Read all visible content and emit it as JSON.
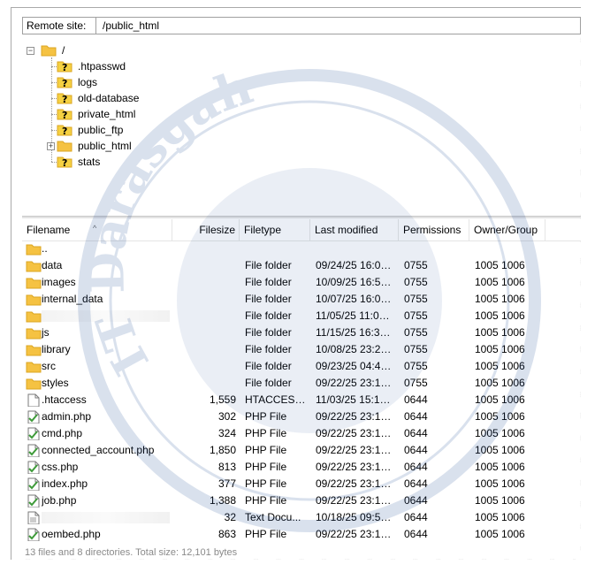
{
  "remote_site": {
    "label": "Remote site:",
    "path": "/public_html"
  },
  "tree": {
    "root": "/",
    "items": [
      {
        "label": ".htpasswd",
        "icon": "unknown-folder-icon"
      },
      {
        "label": "logs",
        "icon": "unknown-folder-icon"
      },
      {
        "label": "old-database",
        "icon": "unknown-folder-icon"
      },
      {
        "label": "private_html",
        "icon": "unknown-folder-icon"
      },
      {
        "label": "public_ftp",
        "icon": "unknown-folder-icon"
      },
      {
        "label": "public_html",
        "icon": "folder-icon",
        "expander": "+"
      },
      {
        "label": "stats",
        "icon": "unknown-folder-icon"
      }
    ]
  },
  "list": {
    "headers": {
      "filename": "Filename",
      "filesize": "Filesize",
      "filetype": "Filetype",
      "last_modified": "Last modified",
      "permissions": "Permissions",
      "owner_group": "Owner/Group"
    },
    "rows": [
      {
        "name": "..",
        "size": "",
        "type": "",
        "modified": "",
        "perm": "",
        "owner": "",
        "icon": "folder-icon"
      },
      {
        "name": "data",
        "size": "",
        "type": "File folder",
        "modified": "09/24/25 16:06:...",
        "perm": "0755",
        "owner": "1005 1006",
        "icon": "folder-icon"
      },
      {
        "name": "images",
        "size": "",
        "type": "File folder",
        "modified": "10/09/25 16:52:...",
        "perm": "0755",
        "owner": "1005 1006",
        "icon": "folder-icon"
      },
      {
        "name": "internal_data",
        "size": "",
        "type": "File folder",
        "modified": "10/07/25 16:07:...",
        "perm": "0755",
        "owner": "1005 1006",
        "icon": "folder-icon"
      },
      {
        "name": "",
        "size": "",
        "type": "File folder",
        "modified": "11/05/25 11:02:...",
        "perm": "0755",
        "owner": "1005 1006",
        "icon": "folder-icon",
        "redacted": true
      },
      {
        "name": "js",
        "size": "",
        "type": "File folder",
        "modified": "11/15/25 16:38:...",
        "perm": "0755",
        "owner": "1005 1006",
        "icon": "folder-icon"
      },
      {
        "name": "library",
        "size": "",
        "type": "File folder",
        "modified": "10/08/25 23:23:...",
        "perm": "0755",
        "owner": "1005 1006",
        "icon": "folder-icon"
      },
      {
        "name": "src",
        "size": "",
        "type": "File folder",
        "modified": "09/23/25 04:42:...",
        "perm": "0755",
        "owner": "1005 1006",
        "icon": "folder-icon"
      },
      {
        "name": "styles",
        "size": "",
        "type": "File folder",
        "modified": "09/22/25 23:16:...",
        "perm": "0755",
        "owner": "1005 1006",
        "icon": "folder-icon"
      },
      {
        "name": ".htaccess",
        "size": "1,559",
        "type": "HTACCESS ...",
        "modified": "11/03/25 15:19:...",
        "perm": "0644",
        "owner": "1005 1006",
        "icon": "file-icon"
      },
      {
        "name": "admin.php",
        "size": "302",
        "type": "PHP File",
        "modified": "09/22/25 23:16:...",
        "perm": "0644",
        "owner": "1005 1006",
        "icon": "php-file-icon"
      },
      {
        "name": "cmd.php",
        "size": "324",
        "type": "PHP File",
        "modified": "09/22/25 23:16:...",
        "perm": "0644",
        "owner": "1005 1006",
        "icon": "php-file-icon"
      },
      {
        "name": "connected_account.php",
        "size": "1,850",
        "type": "PHP File",
        "modified": "09/22/25 23:16:...",
        "perm": "0644",
        "owner": "1005 1006",
        "icon": "php-file-icon"
      },
      {
        "name": "css.php",
        "size": "813",
        "type": "PHP File",
        "modified": "09/22/25 23:16:...",
        "perm": "0644",
        "owner": "1005 1006",
        "icon": "php-file-icon"
      },
      {
        "name": "index.php",
        "size": "377",
        "type": "PHP File",
        "modified": "09/22/25 23:16:...",
        "perm": "0644",
        "owner": "1005 1006",
        "icon": "php-file-icon"
      },
      {
        "name": "job.php",
        "size": "1,388",
        "type": "PHP File",
        "modified": "09/22/25 23:16:...",
        "perm": "0644",
        "owner": "1005 1006",
        "icon": "php-file-icon"
      },
      {
        "name": "",
        "size": "32",
        "type": "Text Docu...",
        "modified": "10/18/25 09:54:...",
        "perm": "0644",
        "owner": "1005 1006",
        "icon": "text-file-icon",
        "redacted": true
      },
      {
        "name": "oembed.php",
        "size": "863",
        "type": "PHP File",
        "modified": "09/22/25 23:16:...",
        "perm": "0644",
        "owner": "1005 1006",
        "icon": "php-file-icon"
      }
    ]
  },
  "status": "13 files and 8 directories. Total size: 12,101 bytes",
  "watermark": {
    "text": "IT Darasgah",
    "icon": "watermark-seal"
  },
  "colors": {
    "folder": "#f5c242",
    "folder_dark": "#dba521",
    "unknown_badge": "#f5d142",
    "php_green": "#3f9b3a",
    "watermark": "#1c4a94"
  }
}
